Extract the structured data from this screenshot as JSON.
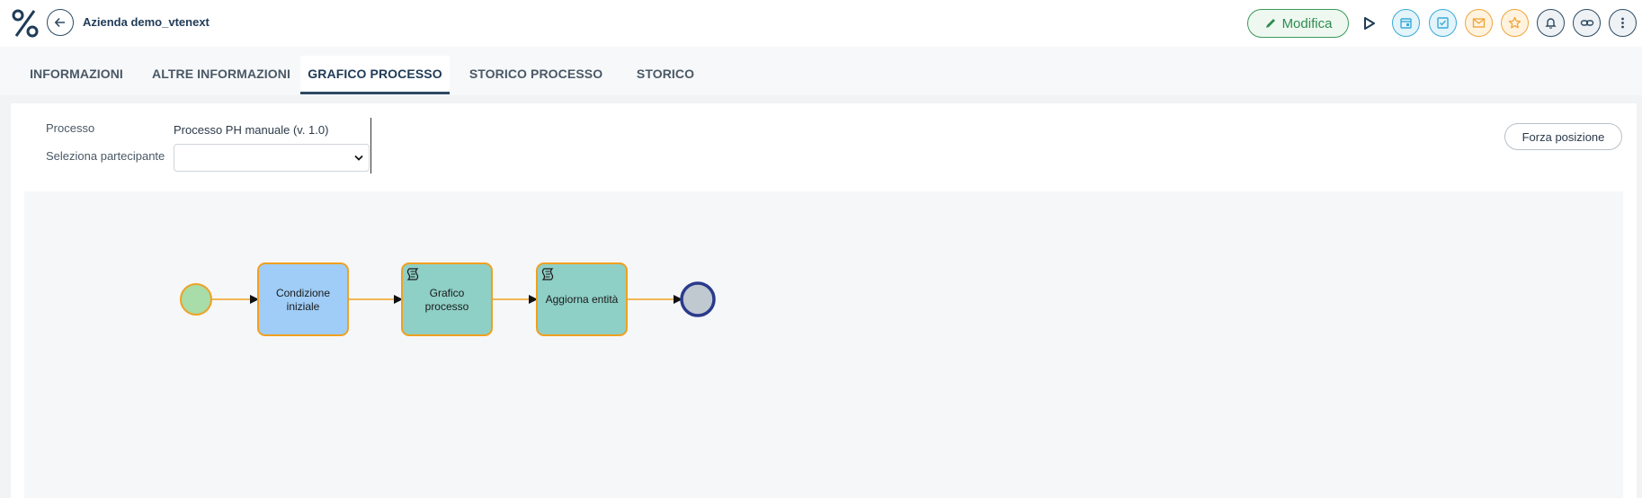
{
  "header": {
    "record_title": "Azienda demo_vtenext",
    "edit_label": "Modifica",
    "actions": [
      {
        "icon": "calendar-icon",
        "color": "#3aaad9"
      },
      {
        "icon": "task-check-icon",
        "color": "#3aaad9"
      },
      {
        "icon": "mail-icon",
        "color": "#f0a43a"
      },
      {
        "icon": "star-icon",
        "color": "#f0a43a"
      },
      {
        "icon": "bell-icon",
        "color": "#2d4a63"
      },
      {
        "icon": "link-icon",
        "color": "#2d4a63"
      },
      {
        "icon": "more-vertical-icon",
        "color": "#2d4a63"
      }
    ]
  },
  "tabs": [
    {
      "label": "INFORMAZIONI",
      "active": false
    },
    {
      "label": "ALTRE INFORMAZIONI",
      "active": false
    },
    {
      "label": "GRAFICO PROCESSO",
      "active": true
    },
    {
      "label": "STORICO PROCESSO",
      "active": false
    },
    {
      "label": "STORICO",
      "active": false
    }
  ],
  "form": {
    "process_label": "Processo",
    "process_value": "Processo PH manuale (v. 1.0)",
    "participant_label": "Seleziona partecipante",
    "participant_value": ""
  },
  "force_position_label": "Forza posizione",
  "diagram": {
    "nodes": [
      {
        "type": "start-event"
      },
      {
        "type": "task",
        "lines": [
          "Condizione",
          "iniziale"
        ],
        "fill": "#9fcdf7"
      },
      {
        "type": "script-task",
        "lines": [
          "Grafico",
          "processo"
        ],
        "fill": "#8ecfc6"
      },
      {
        "type": "script-task",
        "lines": [
          "Aggiorna entità"
        ],
        "fill": "#8ecfc6"
      },
      {
        "type": "end-event"
      }
    ],
    "colors": {
      "border": "#f0a020",
      "start_fill": "#a8dca8",
      "end_fill": "#c0c8d0",
      "end_border": "#2a3a8c"
    }
  }
}
